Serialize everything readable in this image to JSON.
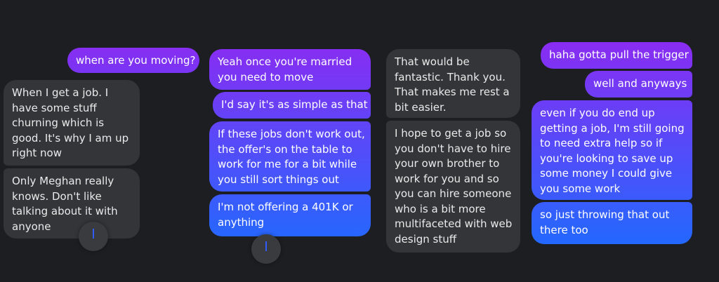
{
  "columns": [
    {
      "messages": [
        {
          "side": "sent",
          "lines": [
            "when are you moving?"
          ]
        },
        {
          "side": "received",
          "lines": [
            "When I get a job. I",
            "have some stuff",
            "churning which is",
            "good. It's why I am up",
            "right now"
          ]
        },
        {
          "side": "received",
          "lines": [
            "Only Meghan really",
            "knows. Don't like",
            "talking about it with",
            "anyone"
          ]
        }
      ]
    },
    {
      "messages": [
        {
          "side": "sent",
          "lines": [
            "Yeah once you're married",
            "you need to move"
          ]
        },
        {
          "side": "sent",
          "lines": [
            "I'd say it's as simple as that"
          ]
        },
        {
          "side": "sent",
          "lines": [
            "If these jobs don't work out,",
            "the offer's on the table to",
            "work for me for a bit while",
            "you still sort things out"
          ]
        },
        {
          "side": "sent",
          "lines": [
            "I'm not offering a 401K or",
            "anything"
          ]
        }
      ]
    },
    {
      "messages": [
        {
          "side": "received",
          "lines": [
            "That would be",
            "fantastic. Thank you.",
            "That makes me rest a",
            "bit easier."
          ]
        },
        {
          "side": "received",
          "lines": [
            "I hope to get a job so",
            "you don't have to hire",
            "your own brother to",
            "work for you and so",
            "you can hire someone",
            "who is a bit more",
            "multifaceted with web",
            "design stuff"
          ]
        }
      ]
    },
    {
      "messages": [
        {
          "side": "sent",
          "lines": [
            "haha gotta pull the trigger"
          ]
        },
        {
          "side": "sent",
          "lines": [
            "well and anyways"
          ]
        },
        {
          "side": "sent",
          "lines": [
            "even if you do end up",
            "getting a job, I'm still going",
            "to need extra help so if",
            "you're looking to save up",
            "some money I could give",
            "you some work"
          ]
        },
        {
          "side": "sent",
          "lines": [
            "so just throwing that out",
            "there too"
          ]
        }
      ]
    }
  ],
  "colors": {
    "background": "#1d1e21",
    "received": "#343538",
    "sent_gradient_top": "#8a2cf2",
    "sent_gradient_bottom": "#1f6bff"
  },
  "icons": [
    "scroll-to-bottom-icon"
  ]
}
